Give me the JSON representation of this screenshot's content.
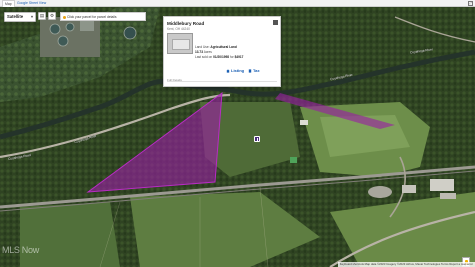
{
  "tabs": [
    {
      "label": "Map",
      "active": true
    },
    {
      "label": "Google Street View",
      "active": false
    }
  ],
  "map_controls": {
    "map_type": "Satellite",
    "layers_icon": "layers-icon",
    "settings_icon": "gear-icon",
    "hint_text": "Click your parcel for parcel details"
  },
  "popup": {
    "title": "Middlebury Road",
    "subtitle": "Kent, OH 44240",
    "land_use_label": "Land Use:",
    "land_use_value": "Agricultural Land",
    "acres_value": "13.73",
    "acres_label": "Acres",
    "last_sold_prefix": "Last sold on",
    "last_sold_date": "01/20/1998",
    "last_sold_for": "for",
    "last_sold_price": "$4917",
    "listing_label": "Listing",
    "tax_label": "Tax",
    "more_label": "Full Details"
  },
  "labels": {
    "road_1": "Cuyahoga River",
    "road_2": "Cuyahoga River",
    "road_3": "Cuyahoga Road",
    "road_4": "Cuyahoga River",
    "watermark": "MLS Now",
    "attribution": "Keyboard shortcuts  Map data ©2023 Imagery ©2023 Airbus, Maxar Technologies  Terms  Report a map error"
  },
  "colors": {
    "parcel_fill": "#9a1fa3",
    "parcel_outline": "#b82cc4",
    "link": "#1a5fb4"
  }
}
